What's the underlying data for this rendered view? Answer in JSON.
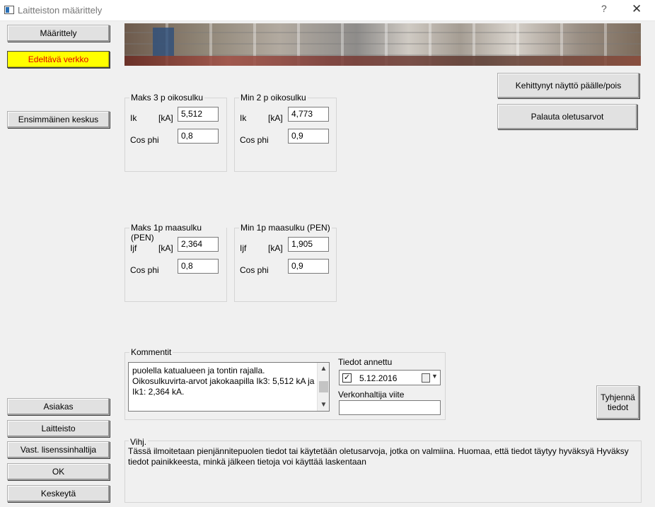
{
  "window": {
    "title": "Laitteiston määrittely",
    "help_glyph": "?",
    "close_glyph": "✕"
  },
  "left_buttons": {
    "maarittely": "Määrittely",
    "edellinen_verkko": "Edeltävä verkko",
    "ensimmainen_keskus": "Ensimmäinen keskus",
    "asiakas": "Asiakas",
    "laitteisto": "Laitteisto",
    "lisenssinhaltija": "Vast. lisenssinhaltija",
    "ok": "OK",
    "keskeyta": "Keskeytä"
  },
  "right_buttons": {
    "advanced_view": "Kehittynyt näyttö päälle/pois",
    "restore_defaults": "Palauta oletusarvot",
    "clear_line1": "Tyhjennä",
    "clear_line2": "tiedot"
  },
  "groups": {
    "max3p": {
      "title": "Maks 3 p oikosulku",
      "field1_label": "Ik",
      "unit": "[kA]",
      "field1_value": "5,512",
      "field2_label": "Cos phi",
      "field2_value": "0,8"
    },
    "min2p": {
      "title": "Min 2 p oikosulku",
      "field1_label": "Ik",
      "unit": "[kA]",
      "field1_value": "4,773",
      "field2_label": "Cos phi",
      "field2_value": "0,9"
    },
    "max1p": {
      "title": "Maks 1p maasulku (PEN)",
      "field1_label": "Ijf",
      "unit": "[kA]",
      "field1_value": "2,364",
      "field2_label": "Cos phi",
      "field2_value": "0,8"
    },
    "min1p": {
      "title": "Min 1p maasulku (PEN)",
      "field1_label": "Ijf",
      "unit": "[kA]",
      "field1_value": "1,905",
      "field2_label": "Cos phi",
      "field2_value": "0,9"
    }
  },
  "comment": {
    "title": "Kommentit",
    "text": "puolella katualueen ja tontin rajalla. Oikosulkuvirta-arvot jakokaapilla Ik3: 5,512 kA ja Ik1: 2,364 kA."
  },
  "data_given": {
    "label": "Tiedot annettu",
    "checked": true,
    "check_glyph": "✓",
    "date": "5.12.2016"
  },
  "operator_ref": {
    "label": "Verkonhaltija viite",
    "value": ""
  },
  "hint": {
    "title": "Vihj.",
    "text": "Tässä ilmoitetaan pienjännitepuolen tiedot tai käytetään oletusarvoja, jotka on valmiina. Huomaa, että tiedot täytyy hyväksyä Hyväksy tiedot painikkeesta, minkä jälkeen tietoja voi käyttää laskentaan"
  }
}
